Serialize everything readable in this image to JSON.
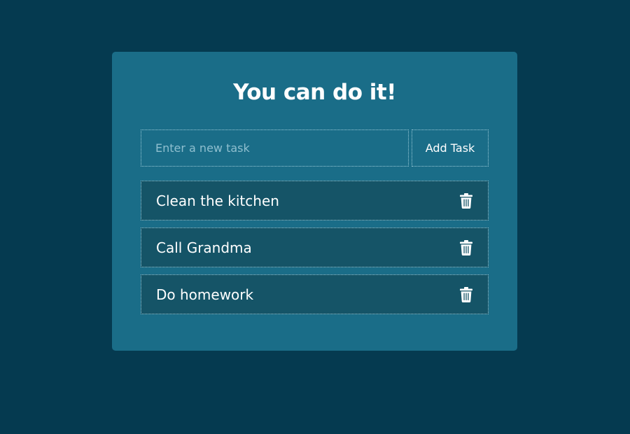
{
  "app": {
    "title": "You can do it!"
  },
  "new_task": {
    "placeholder": "Enter a new task",
    "value": "",
    "add_label": "Add Task"
  },
  "tasks": [
    {
      "text": "Clean the kitchen",
      "delete_icon": "trash-icon"
    },
    {
      "text": "Call Grandma",
      "delete_icon": "trash-icon"
    },
    {
      "text": "Do homework",
      "delete_icon": "trash-icon"
    }
  ],
  "colors": {
    "background": "#053a50",
    "card": "#1a6d88",
    "task_item": "#155467",
    "border": "#9ccbd9",
    "text": "#ffffff",
    "placeholder": "#8fbfcf"
  }
}
